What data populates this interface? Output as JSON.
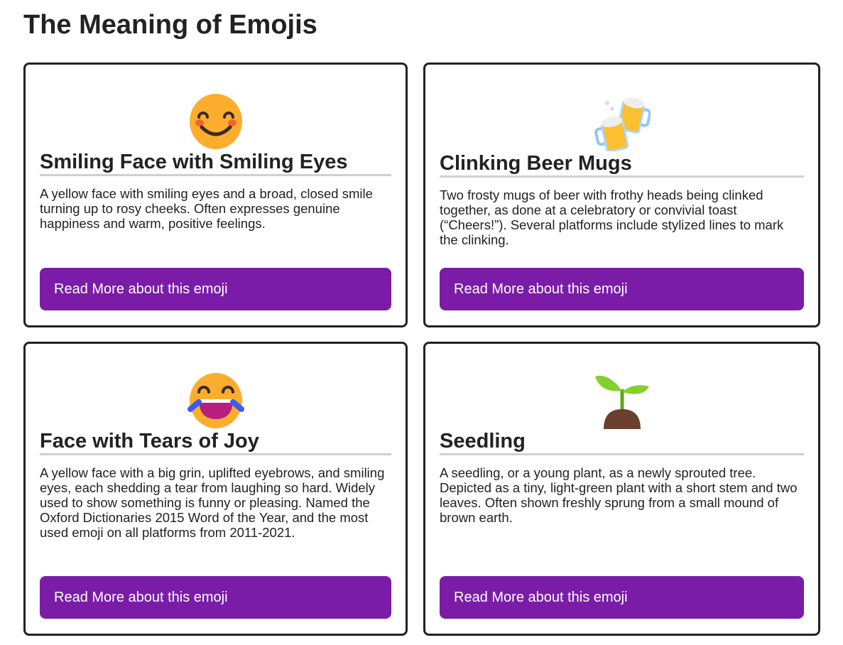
{
  "page": {
    "title": "The Meaning of Emojis"
  },
  "colors": {
    "button": "#7a1ca8",
    "border": "#222222",
    "underline": "#d0d0d0"
  },
  "cards": [
    {
      "icon": "smiling-face-with-smiling-eyes",
      "title": "Smiling Face with Smiling Eyes",
      "description": "A yellow face with smiling eyes and a broad, closed smile turning up to rosy cheeks. Often expresses genuine happiness and warm, positive feelings.",
      "button": "Read More about this emoji"
    },
    {
      "icon": "clinking-beer-mugs",
      "title": "Clinking Beer Mugs",
      "description": "Two frosty mugs of beer with frothy heads being clinked together, as done at a celebratory or convivial toast (“Cheers!”). Several platforms include stylized lines to mark the clinking.",
      "button": "Read More about this emoji"
    },
    {
      "icon": "face-with-tears-of-joy",
      "title": "Face with Tears of Joy",
      "description": "A yellow face with a big grin, uplifted eyebrows, and smiling eyes, each shedding a tear from laughing so hard. Widely used to show something is funny or pleasing. Named the Oxford Dictionaries 2015 Word of the Year, and the most used emoji on all platforms from 2011-2021.",
      "button": "Read More about this emoji"
    },
    {
      "icon": "seedling",
      "title": "Seedling",
      "description": "A seedling, or a young plant, as a newly sprouted tree. Depicted as a tiny, light-green plant with a short stem and two leaves. Often shown freshly sprung from a small mound of brown earth.",
      "button": "Read More about this emoji"
    }
  ]
}
